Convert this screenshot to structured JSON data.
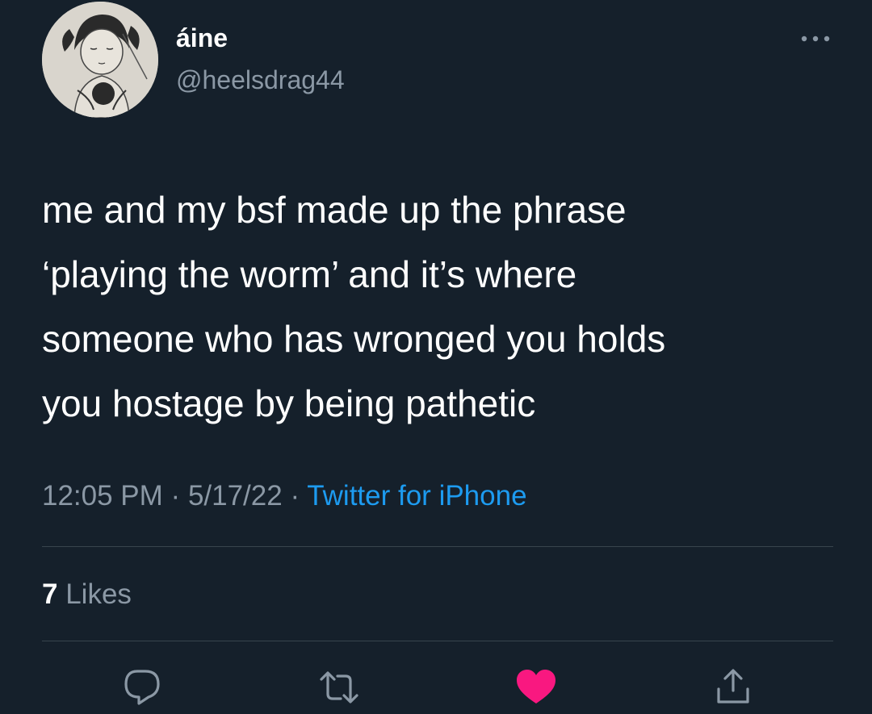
{
  "user": {
    "display_name": "áine",
    "handle": "@heelsdrag44",
    "avatar_icon": "profile-avatar"
  },
  "tweet": {
    "text_lines": [
      "me and my bsf made up the phrase",
      "‘playing the worm’ and it’s where",
      "someone who has wronged you holds",
      "you hostage by being pathetic"
    ],
    "time": "12:05 PM",
    "date": "5/17/22",
    "separator": "·",
    "source": "Twitter for iPhone"
  },
  "stats": {
    "likes_count": "7",
    "likes_label": "Likes"
  },
  "actions": {
    "reply_icon": "reply-icon",
    "retweet_icon": "retweet-icon",
    "like_icon": "heart-icon",
    "liked": true,
    "share_icon": "share-icon"
  },
  "colors": {
    "background": "#15202b",
    "secondary_text": "#8b98a5",
    "link": "#1d9bf0",
    "like": "#f91880"
  }
}
